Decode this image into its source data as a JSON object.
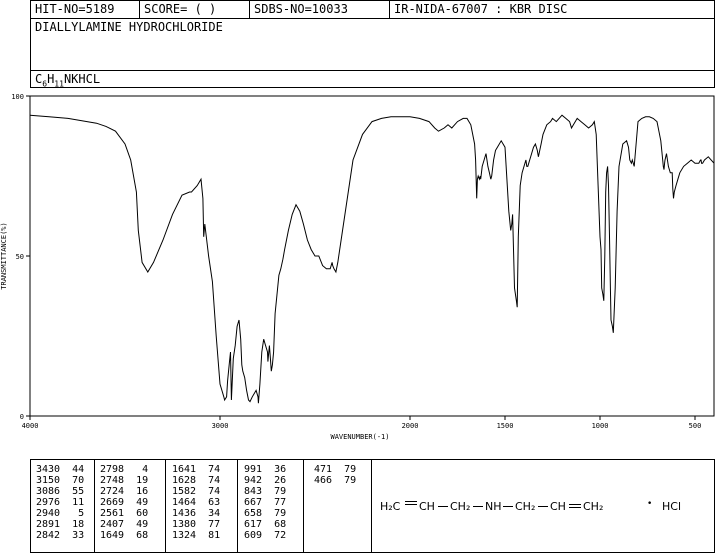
{
  "header": {
    "hit_no": "HIT-NO=5189",
    "score": "SCORE=  (   )",
    "sdbs_no": "SDBS-NO=10033",
    "ir_nida": "IR-NIDA-67007 : KBR DISC"
  },
  "compound": {
    "name": "DIALLYLAMINE HYDROCHLORIDE",
    "formula_c": "C",
    "formula_c_sub": "6",
    "formula_h": "H",
    "formula_h_sub": "11",
    "formula_rest": "NKHCL"
  },
  "structure": {
    "h2c": "H₂C",
    "ch1": "CH",
    "ch2a": "CH₂",
    "nh": "NH",
    "ch2b": "CH₂",
    "ch2": "CH",
    "ch2c": "CH₂",
    "dot": "•",
    "hcl": "HCl"
  },
  "peak_table": {
    "col1": [
      "3430  44",
      "3150  70",
      "3086  55",
      "2976  11",
      "2940   5",
      "2891  18",
      "2842  33"
    ],
    "col2": [
      "2798   4",
      "2748  19",
      "2724  16",
      "2669  49",
      "2561  60",
      "2407  49",
      "1649  68"
    ],
    "col3": [
      "1641  74",
      "1628  74",
      "1582  74",
      "1464  63",
      "1436  34",
      "1380  77",
      "1324  81"
    ],
    "col4": [
      "991  36",
      "942  26",
      "843  79",
      "667  77",
      "658  79",
      "617  68",
      "609  72"
    ],
    "col5": [
      "471  79",
      "466  79"
    ]
  },
  "chart_data": {
    "type": "line",
    "xlabel": "WAVENUMBER(-1)",
    "ylabel": "TRANSMITTANCE(%)",
    "xlim": [
      4000,
      400
    ],
    "ylim": [
      0,
      100
    ],
    "x_ticks": [
      4000,
      3000,
      2000,
      1500,
      1000,
      500
    ],
    "x_tick_labels": [
      "4000",
      "3000",
      "2000",
      "1500",
      "1000",
      "500"
    ],
    "y_ticks": [
      0,
      50,
      100
    ],
    "y_tick_labels": [
      "0",
      "50",
      "100"
    ],
    "grid": false,
    "series": [
      {
        "x": [
          4000,
          3900,
          3800,
          3700,
          3650,
          3600,
          3550,
          3500,
          3470,
          3440,
          3430,
          3410,
          3380,
          3350,
          3300,
          3250,
          3200,
          3160,
          3150,
          3120,
          3100,
          3090,
          3086,
          3080,
          3060,
          3040,
          3020,
          3000,
          2990,
          2980,
          2976,
          2965,
          2960,
          2950,
          2945,
          2940,
          2930,
          2920,
          2910,
          2900,
          2891,
          2885,
          2880,
          2870,
          2860,
          2850,
          2842,
          2830,
          2810,
          2800,
          2798,
          2790,
          2780,
          2770,
          2760,
          2750,
          2748,
          2740,
          2735,
          2730,
          2724,
          2718,
          2710,
          2700,
          2690,
          2680,
          2669,
          2660,
          2640,
          2620,
          2600,
          2580,
          2561,
          2540,
          2520,
          2500,
          2480,
          2460,
          2440,
          2420,
          2410,
          2407,
          2400,
          2390,
          2380,
          2350,
          2300,
          2250,
          2200,
          2150,
          2100,
          2050,
          2000,
          1950,
          1900,
          1870,
          1850,
          1820,
          1800,
          1780,
          1750,
          1720,
          1700,
          1680,
          1670,
          1660,
          1655,
          1649,
          1645,
          1641,
          1635,
          1630,
          1628,
          1620,
          1610,
          1600,
          1590,
          1582,
          1575,
          1570,
          1560,
          1550,
          1540,
          1520,
          1500,
          1490,
          1480,
          1470,
          1464,
          1460,
          1450,
          1440,
          1436,
          1430,
          1420,
          1410,
          1400,
          1390,
          1385,
          1380,
          1370,
          1360,
          1350,
          1340,
          1330,
          1324,
          1310,
          1300,
          1280,
          1260,
          1250,
          1230,
          1200,
          1180,
          1160,
          1150,
          1140,
          1120,
          1100,
          1080,
          1060,
          1040,
          1030,
          1020,
          1010,
          1000,
          995,
          991,
          985,
          980,
          975,
          970,
          965,
          960,
          955,
          950,
          945,
          942,
          935,
          930,
          920,
          910,
          900,
          880,
          860,
          850,
          843,
          835,
          830,
          820,
          810,
          800,
          780,
          760,
          740,
          720,
          700,
          690,
          680,
          670,
          667,
          663,
          660,
          658,
          650,
          640,
          630,
          620,
          617,
          613,
          609,
          600,
          590,
          580,
          560,
          540,
          520,
          500,
          490,
          480,
          471,
          468,
          466,
          460,
          450,
          430,
          400
        ],
        "y": [
          94,
          93.5,
          93,
          92,
          91.5,
          90.5,
          89,
          85,
          80,
          70,
          58,
          48,
          45,
          48,
          55,
          63,
          69,
          70,
          70,
          72,
          74,
          68,
          56,
          60,
          50,
          42,
          25,
          10,
          8,
          6,
          5,
          6,
          11,
          17,
          20,
          5,
          18,
          22,
          28,
          30,
          24,
          16,
          14,
          12,
          8,
          5,
          4.5,
          6,
          8,
          6,
          4,
          10,
          20,
          24,
          22,
          20,
          17,
          22,
          18,
          14,
          16,
          20,
          32,
          38,
          44,
          46,
          49,
          52,
          58,
          63,
          66,
          64,
          60,
          55,
          52,
          50,
          50,
          47,
          46,
          46,
          48,
          47,
          46,
          45,
          48,
          60,
          80,
          88,
          92,
          93,
          93.5,
          93.5,
          93.5,
          93,
          92,
          90,
          89,
          90,
          91,
          90,
          92,
          93,
          93,
          91,
          88,
          85,
          80,
          68,
          74,
          75,
          74,
          75,
          74,
          78,
          80,
          82,
          78,
          76,
          74,
          75,
          80,
          83,
          84,
          86,
          84,
          74,
          64,
          58,
          60,
          63,
          40,
          36,
          34,
          56,
          72,
          76,
          78,
          80,
          78,
          78,
          80,
          82,
          84,
          85,
          83,
          81,
          85,
          88,
          91,
          92,
          93,
          92,
          94,
          93,
          92,
          90,
          91,
          93,
          92,
          91,
          90,
          91,
          92,
          88,
          72,
          56,
          52,
          40,
          38,
          36,
          50,
          70,
          76,
          78,
          72,
          56,
          40,
          30,
          28,
          26,
          40,
          64,
          78,
          85,
          86,
          84,
          80,
          79,
          80,
          78,
          85,
          92,
          93,
          93.5,
          93.5,
          93,
          92,
          89,
          86,
          80,
          78,
          77,
          79,
          80,
          82,
          78,
          76,
          76,
          71,
          68,
          70,
          72,
          74,
          76,
          78,
          79,
          80,
          79,
          79,
          79,
          80,
          80,
          79,
          79,
          80,
          81,
          79
        ]
      }
    ]
  }
}
